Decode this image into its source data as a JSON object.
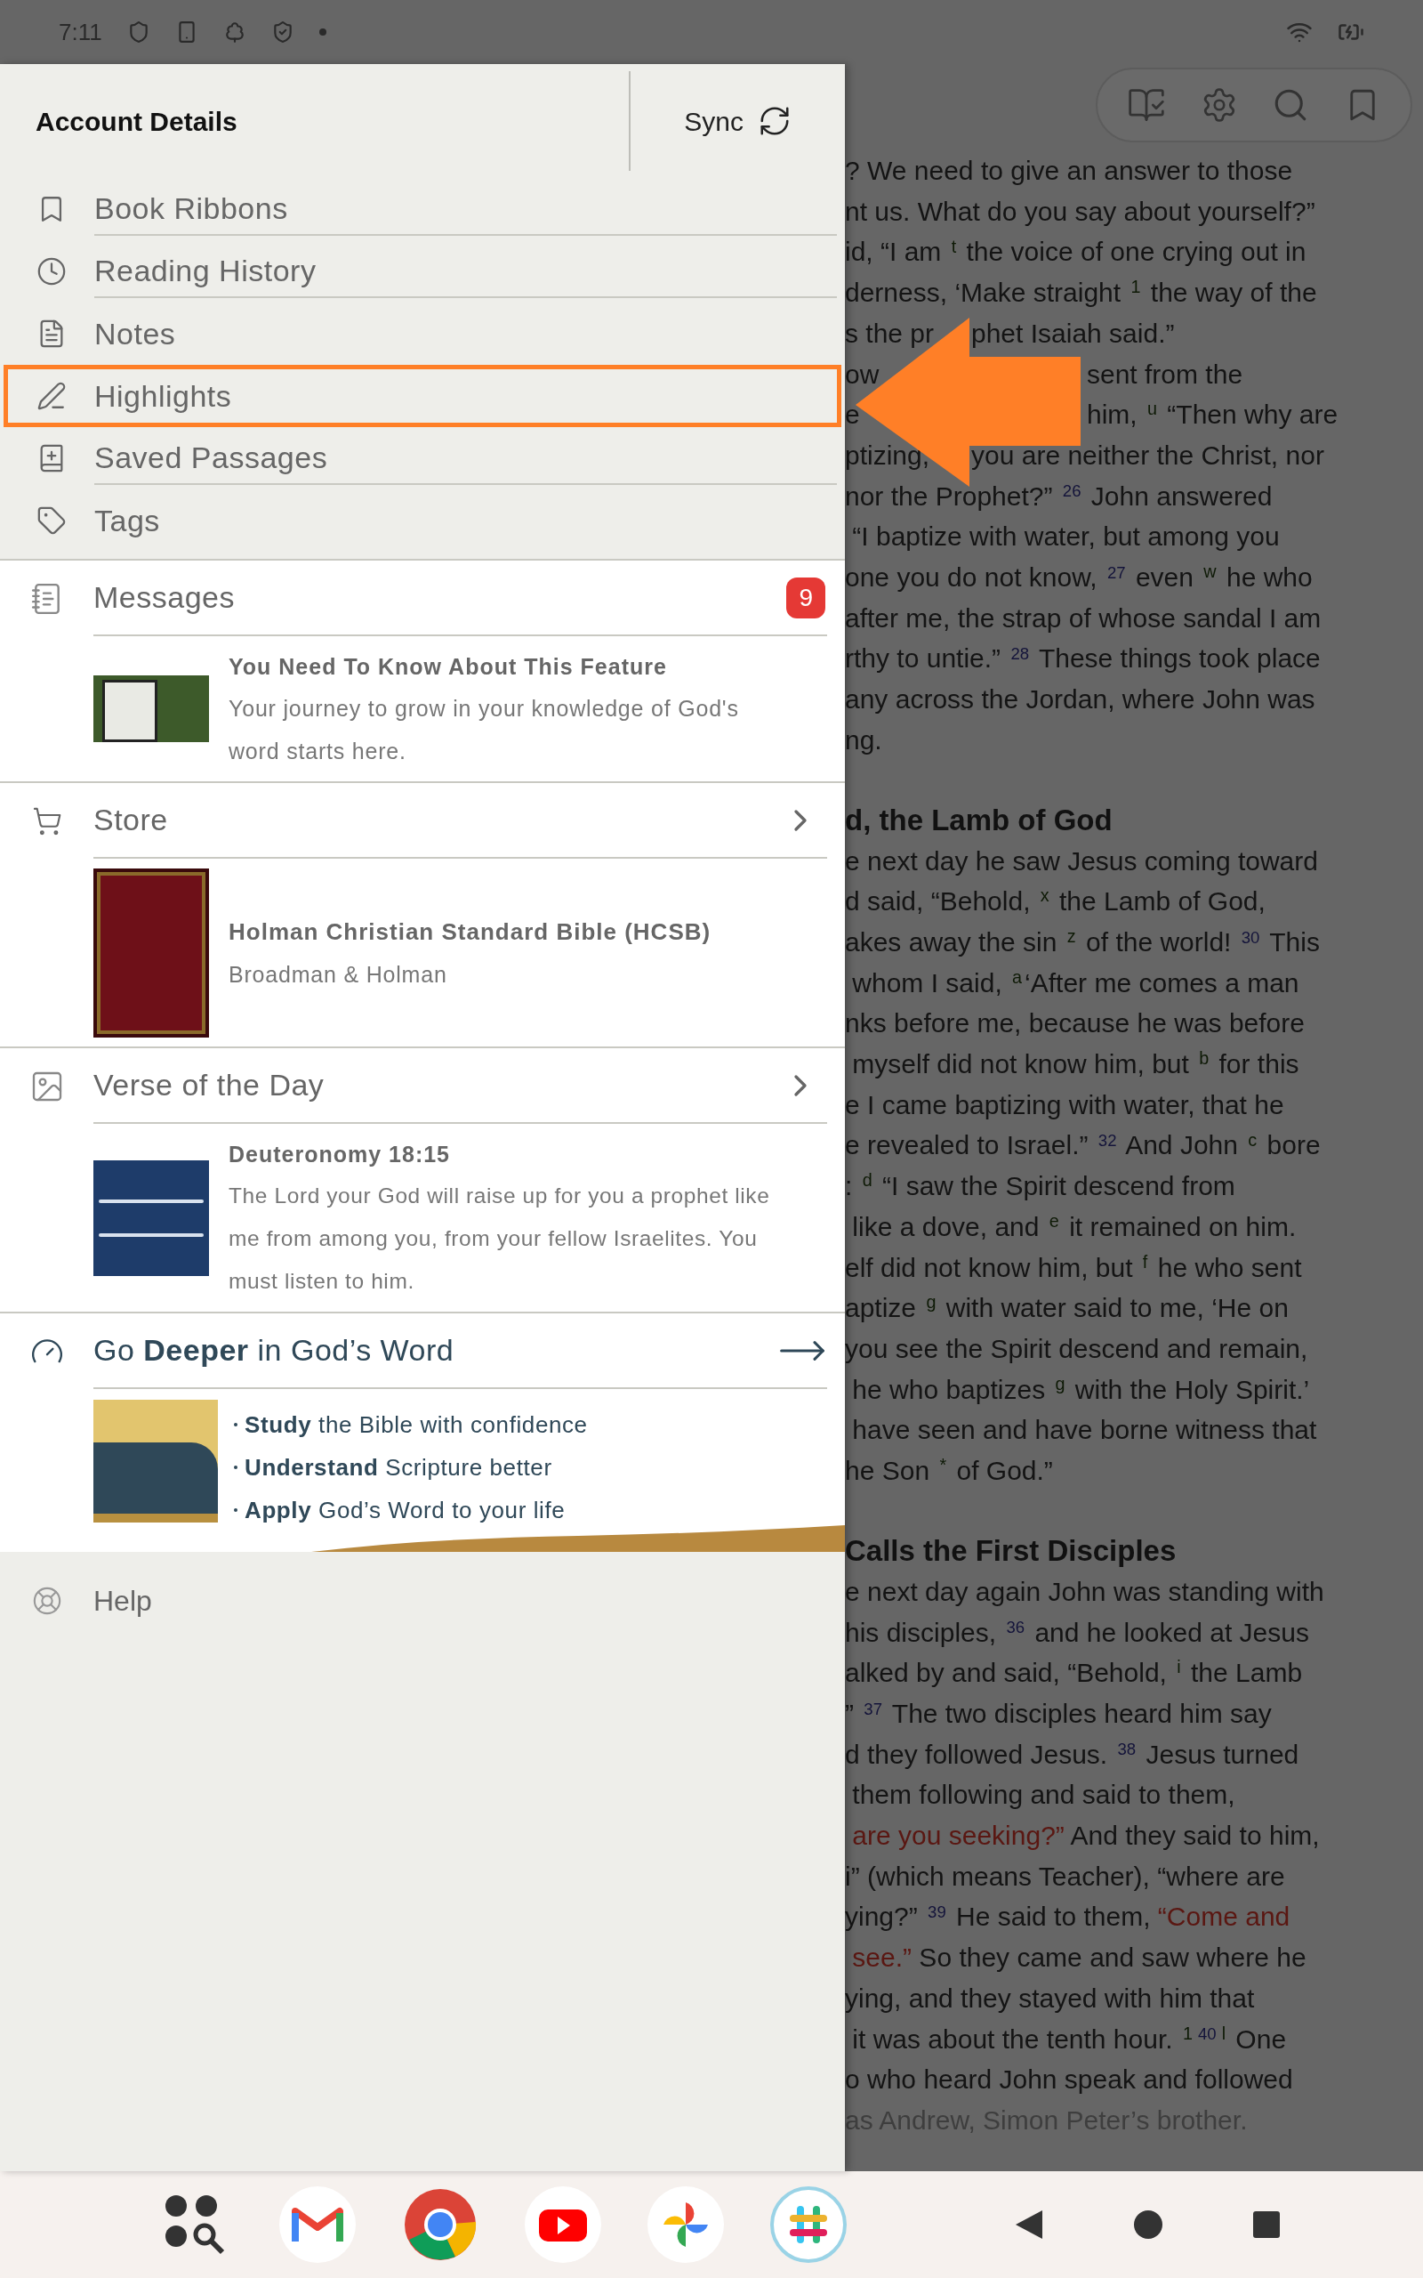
{
  "status_bar": {
    "time": "7:11"
  },
  "drawer": {
    "header": {
      "title": "Account Details",
      "sync_label": "Sync"
    },
    "items": [
      {
        "label": "Book Ribbons",
        "selected": false
      },
      {
        "label": "Reading History",
        "selected": false
      },
      {
        "label": "Notes",
        "selected": false
      },
      {
        "label": "Highlights",
        "selected": true
      },
      {
        "label": "Saved Passages",
        "selected": false
      },
      {
        "label": "Tags",
        "selected": false
      }
    ],
    "messages": {
      "title": "Messages",
      "badge": "9",
      "card": {
        "title": "You Need To Know About This Feature",
        "body": "Your journey to grow in your knowledge of God's word starts here."
      }
    },
    "store": {
      "title": "Store",
      "card": {
        "title": "Holman Christian Standard Bible (HCSB)",
        "subtitle": "Broadman & Holman"
      }
    },
    "verse_of_the_day": {
      "title": "Verse of the Day",
      "card": {
        "reference": "Deuteronomy 18:15",
        "text": "The Lord your God will raise up for you a prophet like me from among you, from your fellow Israelites. You must listen to him."
      }
    },
    "promo": {
      "title": "Go **Deeper** in God’s Word",
      "bullets": [
        "**Study** the Bible with confidence",
        "**Understand** Scripture better",
        "**Apply** God’s Word to your life"
      ]
    },
    "help": {
      "label": "Help"
    }
  },
  "reader": {
    "blocks": [
      {
        "kind": "line",
        "segments": [
          {
            "kind": "text",
            "text": "? We need to give an answer to those"
          }
        ]
      },
      {
        "kind": "line",
        "segments": [
          {
            "kind": "text",
            "text": "nt us. What do you say about yourself?”"
          }
        ]
      },
      {
        "kind": "line",
        "segments": [
          {
            "kind": "text",
            "text": "id, “I am "
          },
          {
            "kind": "note",
            "text": "t"
          },
          {
            "kind": "text",
            "text": " the voice of one crying out in"
          }
        ]
      },
      {
        "kind": "line",
        "segments": [
          {
            "kind": "text",
            "text": "derness, ‘Make straight "
          },
          {
            "kind": "note",
            "text": "1"
          },
          {
            "kind": "text",
            "text": " the way of the"
          }
        ]
      },
      {
        "kind": "split_head",
        "before": [
          {
            "kind": "text",
            "text": "s the pr"
          }
        ],
        "after": [
          {
            "kind": "text",
            "text": "phet Isaiah said.”"
          }
        ]
      },
      {
        "kind": "split_tail",
        "before": [
          {
            "kind": "text",
            "text": "ow"
          }
        ],
        "after": [
          {
            "kind": "text",
            "text": "sent from the"
          }
        ]
      },
      {
        "kind": "split_tail",
        "before": [
          {
            "kind": "text",
            "text": "e"
          }
        ],
        "after": [
          {
            "kind": "text",
            "text": "him, "
          },
          {
            "kind": "note",
            "text": "u"
          },
          {
            "kind": "text",
            "text": " “Then why are"
          }
        ]
      },
      {
        "kind": "split_head",
        "before": [
          {
            "kind": "text",
            "text": "ptizing,"
          }
        ],
        "after": [
          {
            "kind": "text",
            "text": "you are neither the Christ, nor"
          }
        ]
      },
      {
        "kind": "line",
        "segments": [
          {
            "kind": "text",
            "text": "nor the Prophet?” "
          },
          {
            "kind": "verse",
            "text": "26"
          },
          {
            "kind": "text",
            "text": " John answered"
          }
        ]
      },
      {
        "kind": "line",
        "segments": [
          {
            "kind": "text",
            "text": " “I baptize with water, but among you"
          }
        ]
      },
      {
        "kind": "line",
        "segments": [
          {
            "kind": "text",
            "text": "one you do not know, "
          },
          {
            "kind": "verse",
            "text": "27"
          },
          {
            "kind": "text",
            "text": " even "
          },
          {
            "kind": "note",
            "text": "w"
          },
          {
            "kind": "text",
            "text": " he who"
          }
        ]
      },
      {
        "kind": "line",
        "segments": [
          {
            "kind": "text",
            "text": "after me, the strap of whose sandal I am"
          }
        ]
      },
      {
        "kind": "line",
        "segments": [
          {
            "kind": "text",
            "text": "rthy to untie.” "
          },
          {
            "kind": "verse",
            "text": "28"
          },
          {
            "kind": "text",
            "text": " These things took place"
          }
        ]
      },
      {
        "kind": "line",
        "segments": [
          {
            "kind": "text",
            "text": "any across the Jordan, where John was"
          }
        ]
      },
      {
        "kind": "line",
        "segments": [
          {
            "kind": "text",
            "text": "ng."
          }
        ]
      },
      {
        "kind": "heading",
        "text": "d, the Lamb of God"
      },
      {
        "kind": "line",
        "segments": [
          {
            "kind": "text",
            "text": "e next day he saw Jesus coming toward"
          }
        ]
      },
      {
        "kind": "line",
        "segments": [
          {
            "kind": "text",
            "text": "d said, “Behold, "
          },
          {
            "kind": "note",
            "text": "x"
          },
          {
            "kind": "text",
            "text": " the Lamb of God,"
          }
        ]
      },
      {
        "kind": "line",
        "segments": [
          {
            "kind": "text",
            "text": "akes away the sin "
          },
          {
            "kind": "note",
            "text": "z"
          },
          {
            "kind": "text",
            "text": " of the world! "
          },
          {
            "kind": "verse",
            "text": "30"
          },
          {
            "kind": "text",
            "text": " This"
          }
        ]
      },
      {
        "kind": "line",
        "segments": [
          {
            "kind": "text",
            "text": " whom I said, "
          },
          {
            "kind": "note",
            "text": "a"
          },
          {
            "kind": "text",
            "text": "‘After me comes a man"
          }
        ]
      },
      {
        "kind": "line",
        "segments": [
          {
            "kind": "text",
            "text": "nks before me, because he was before"
          }
        ]
      },
      {
        "kind": "line",
        "segments": [
          {
            "kind": "text",
            "text": " myself did not know him, but "
          },
          {
            "kind": "note",
            "text": "b"
          },
          {
            "kind": "text",
            "text": " for this"
          }
        ]
      },
      {
        "kind": "line",
        "segments": [
          {
            "kind": "text",
            "text": "e I came baptizing with water, that he"
          }
        ]
      },
      {
        "kind": "line",
        "segments": [
          {
            "kind": "text",
            "text": "e revealed to Israel.” "
          },
          {
            "kind": "verse",
            "text": "32"
          },
          {
            "kind": "text",
            "text": " And John "
          },
          {
            "kind": "note",
            "text": "c"
          },
          {
            "kind": "text",
            "text": " bore"
          }
        ]
      },
      {
        "kind": "line",
        "segments": [
          {
            "kind": "text",
            "text": ": "
          },
          {
            "kind": "note",
            "text": "d"
          },
          {
            "kind": "text",
            "text": " “I saw the Spirit descend from"
          }
        ]
      },
      {
        "kind": "line",
        "segments": [
          {
            "kind": "text",
            "text": " like a dove, and "
          },
          {
            "kind": "note",
            "text": "e"
          },
          {
            "kind": "text",
            "text": " it remained on him."
          }
        ]
      },
      {
        "kind": "line",
        "segments": [
          {
            "kind": "text",
            "text": "elf did not know him, but "
          },
          {
            "kind": "note",
            "text": "f"
          },
          {
            "kind": "text",
            "text": " he who sent"
          }
        ]
      },
      {
        "kind": "line",
        "segments": [
          {
            "kind": "text",
            "text": "aptize "
          },
          {
            "kind": "note",
            "text": "g"
          },
          {
            "kind": "text",
            "text": " with water said to me, ‘He on"
          }
        ]
      },
      {
        "kind": "line",
        "segments": [
          {
            "kind": "text",
            "text": "you see the Spirit descend and remain,"
          }
        ]
      },
      {
        "kind": "line",
        "segments": [
          {
            "kind": "text",
            "text": " he who baptizes "
          },
          {
            "kind": "note",
            "text": "g"
          },
          {
            "kind": "text",
            "text": " with the Holy Spirit.’"
          }
        ]
      },
      {
        "kind": "line",
        "segments": [
          {
            "kind": "text",
            "text": " have seen and have borne witness that"
          }
        ]
      },
      {
        "kind": "line",
        "segments": [
          {
            "kind": "text",
            "text": "he Son "
          },
          {
            "kind": "note",
            "text": "*"
          },
          {
            "kind": "text",
            "text": " of God.”"
          }
        ]
      },
      {
        "kind": "heading",
        "text": "Calls the First Disciples"
      },
      {
        "kind": "line",
        "segments": [
          {
            "kind": "text",
            "text": "e next day again John was standing with"
          }
        ]
      },
      {
        "kind": "line",
        "segments": [
          {
            "kind": "text",
            "text": "his disciples, "
          },
          {
            "kind": "verse",
            "text": "36"
          },
          {
            "kind": "text",
            "text": " and he looked at Jesus"
          }
        ]
      },
      {
        "kind": "line",
        "segments": [
          {
            "kind": "text",
            "text": "alked by and said, “Behold, "
          },
          {
            "kind": "note",
            "text": "i"
          },
          {
            "kind": "text",
            "text": " the Lamb"
          }
        ]
      },
      {
        "kind": "line",
        "segments": [
          {
            "kind": "text",
            "text": "” "
          },
          {
            "kind": "verse",
            "text": "37"
          },
          {
            "kind": "text",
            "text": " The two disciples heard him say"
          }
        ]
      },
      {
        "kind": "line",
        "segments": [
          {
            "kind": "text",
            "text": "d they followed Jesus. "
          },
          {
            "kind": "verse",
            "text": "38"
          },
          {
            "kind": "text",
            "text": " Jesus turned"
          }
        ]
      },
      {
        "kind": "line",
        "segments": [
          {
            "kind": "text",
            "text": " them following and said to them,"
          }
        ]
      },
      {
        "kind": "line",
        "segments": [
          {
            "kind": "red",
            "text": " are you seeking?”"
          },
          {
            "kind": "text",
            "text": " And they said to him,"
          }
        ]
      },
      {
        "kind": "line",
        "segments": [
          {
            "kind": "text",
            "text": "i” (which means Teacher), “where are"
          }
        ]
      },
      {
        "kind": "line",
        "segments": [
          {
            "kind": "text",
            "text": "ying?” "
          },
          {
            "kind": "verse",
            "text": "39"
          },
          {
            "kind": "text",
            "text": " He said to them, "
          },
          {
            "kind": "red",
            "text": "“Come and"
          }
        ]
      },
      {
        "kind": "line",
        "segments": [
          {
            "kind": "red",
            "text": " see.”"
          },
          {
            "kind": "text",
            "text": " So they came and saw where he"
          }
        ]
      },
      {
        "kind": "line",
        "segments": [
          {
            "kind": "text",
            "text": "ying, and they stayed with him that"
          }
        ]
      },
      {
        "kind": "line",
        "segments": [
          {
            "kind": "text",
            "text": " it was about the tenth hour. "
          },
          {
            "kind": "note",
            "text": "1"
          },
          {
            "kind": "verse",
            "text": "40"
          },
          {
            "kind": "note",
            "text": "l"
          },
          {
            "kind": "text",
            "text": " One"
          }
        ]
      },
      {
        "kind": "line",
        "segments": [
          {
            "kind": "text",
            "text": "o who heard John speak and followed"
          }
        ]
      },
      {
        "kind": "faded_line",
        "segments": [
          {
            "kind": "text",
            "text": "as Andrew, Simon Peter’s brother."
          }
        ]
      }
    ]
  }
}
